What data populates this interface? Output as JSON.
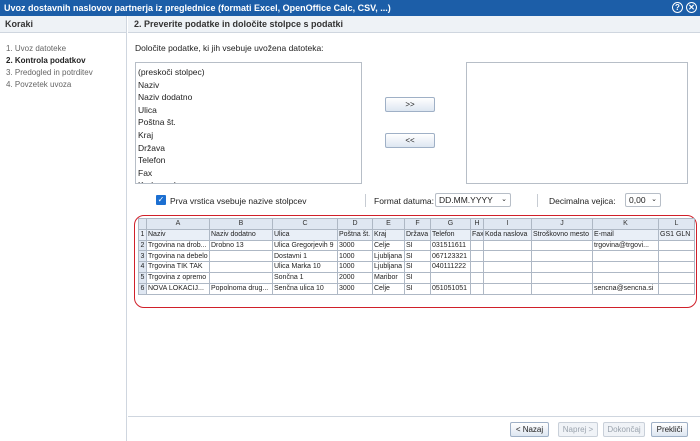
{
  "window": {
    "title": "Uvoz dostavnih naslovov partnerja iz preglednice (formati Excel, OpenOffice Calc, CSV, ...)",
    "help_glyph": "?",
    "close_glyph": "✕"
  },
  "sidebar": {
    "heading": "Koraki",
    "steps": [
      {
        "label": "1. Uvoz datoteke",
        "active": false
      },
      {
        "label": "2. Kontrola podatkov",
        "active": true
      },
      {
        "label": "3. Predogled in potrditev",
        "active": false
      },
      {
        "label": "4. Povzetek uvoza",
        "active": false
      }
    ]
  },
  "main": {
    "heading": "2. Preverite podatke in določite stolpce s podatki",
    "instruction": "Določite podatke, ki jih vsebuje uvožena datoteka:",
    "available_fields": [
      "(preskoči stolpec)",
      "Naziv",
      "Naziv dodatno",
      "Ulica",
      "Poštna št.",
      "Kraj",
      "Država",
      "Telefon",
      "Fax",
      "Koda naslova"
    ],
    "selected_fields": [],
    "add_button": ">>",
    "remove_button": "<<",
    "first_row_label": "Prva vrstica vsebuje nazive stolpcev",
    "checkmark": "✓",
    "date_format_label": "Format datuma:",
    "date_format_value": "DD.MM.YYYY",
    "decimal_label": "Decimalna vejica:",
    "decimal_value": "0,00",
    "chevron": "⌄"
  },
  "grid": {
    "columns": [
      "",
      "A",
      "B",
      "C",
      "D",
      "E",
      "F",
      "G",
      "H",
      "I",
      "J",
      "K",
      "L"
    ],
    "rows": [
      [
        "1",
        "Naziv",
        "Naziv dodatno",
        "Ulica",
        "Poštna št.",
        "Kraj",
        "Država",
        "Telefon",
        "Fax",
        "Koda naslova",
        "Stroškovno mesto",
        "E-mail",
        "GS1 GLN"
      ],
      [
        "2",
        "Trgovina na drob...",
        "Drobno 13",
        "Ulica Gregorjevih 9",
        "3000",
        "Celje",
        "SI",
        "031511611",
        "",
        "",
        "",
        "trgovina@trgovi...",
        ""
      ],
      [
        "3",
        "Trgovina na debelo",
        "",
        "Dostavni 1",
        "1000",
        "Ljubljana",
        "SI",
        "067123321",
        "",
        "",
        "",
        "",
        ""
      ],
      [
        "4",
        "Trgovina TIK TAK",
        "",
        "Ulica Marka 10",
        "1000",
        "Ljubljana",
        "SI",
        "040111222",
        "",
        "",
        "",
        "",
        ""
      ],
      [
        "5",
        "Trgovina z opremo",
        "",
        "Sončna 1",
        "2000",
        "Maribor",
        "SI",
        "",
        "",
        "",
        "",
        "",
        ""
      ],
      [
        "6",
        "NOVA LOKACIJ...",
        "Popolnoma drug...",
        "Senčna ulica 10",
        "3000",
        "Celje",
        "SI",
        "051051051",
        "",
        "",
        "",
        "sencna@sencna.si",
        ""
      ]
    ]
  },
  "footer": {
    "back": "< Nazaj",
    "next": "Naprej >",
    "finish": "Dokončaj",
    "cancel": "Prekliči"
  },
  "colors": {
    "titlebar": "#1c5ea8",
    "highlight": "#d0202a"
  }
}
